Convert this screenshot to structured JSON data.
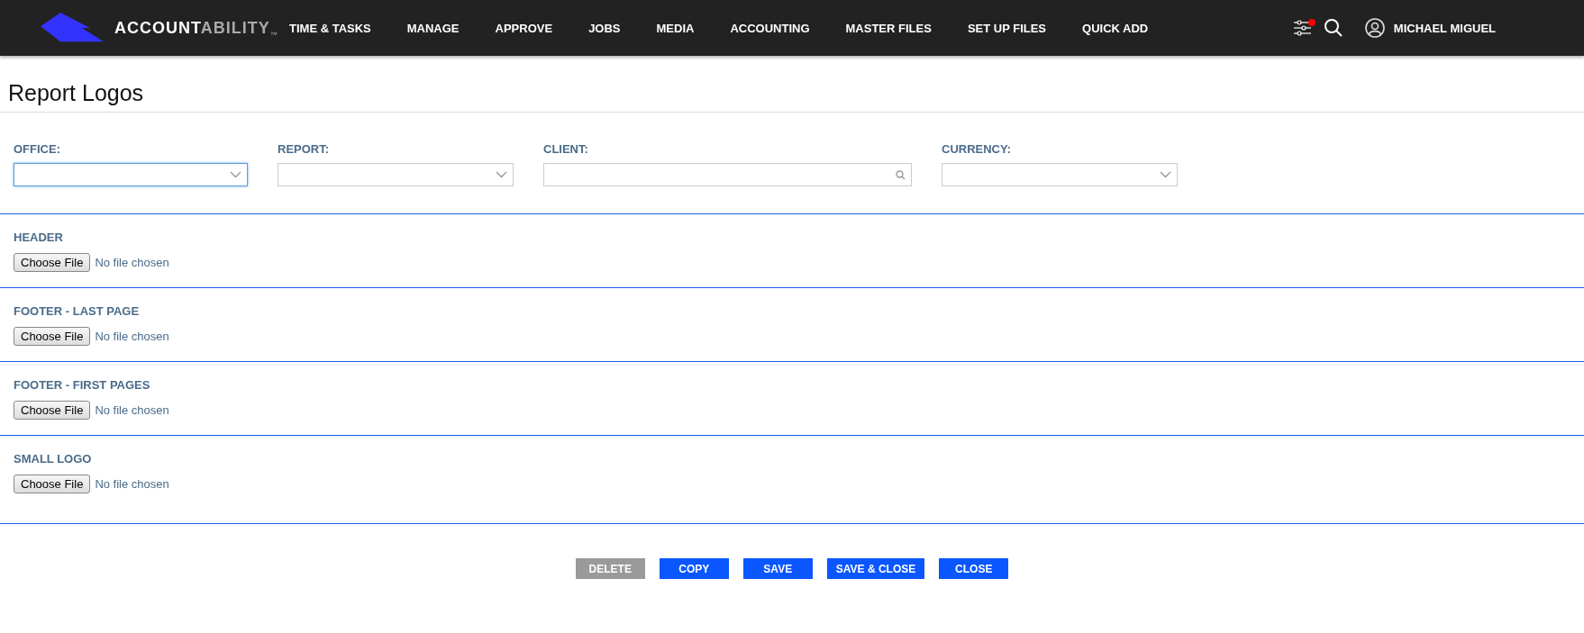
{
  "navbar": {
    "logo_text": "ACCOUNT",
    "logo_text_accent": "ABILITY",
    "trademark": "™",
    "menu": [
      {
        "label": "TIME & TASKS"
      },
      {
        "label": "MANAGE"
      },
      {
        "label": "APPROVE"
      },
      {
        "label": "JOBS"
      },
      {
        "label": "MEDIA"
      },
      {
        "label": "ACCOUNTING"
      },
      {
        "label": "MASTER FILES"
      },
      {
        "label": "SET UP FILES"
      },
      {
        "label": "QUICK ADD"
      }
    ],
    "filters_notification": true,
    "user_name": "MICHAEL MIGUEL"
  },
  "page_title": "Report Logos",
  "filters": [
    {
      "label": "OFFICE:",
      "kind": "select",
      "focused": true
    },
    {
      "label": "REPORT:",
      "kind": "select",
      "focused": false
    },
    {
      "label": "CLIENT:",
      "kind": "search",
      "focused": false
    },
    {
      "label": "CURRENCY:",
      "kind": "select",
      "focused": false
    }
  ],
  "logo_sections": [
    {
      "label": "HEADER",
      "button": "Choose File",
      "status": "No file chosen"
    },
    {
      "label": "FOOTER - LAST PAGE",
      "button": "Choose File",
      "status": "No file chosen"
    },
    {
      "label": "FOOTER - FIRST PAGES",
      "button": "Choose File",
      "status": "No file chosen"
    },
    {
      "label": "SMALL LOGO",
      "button": "Choose File",
      "status": "No file chosen"
    }
  ],
  "actions": [
    {
      "label": "DELETE",
      "disabled": true
    },
    {
      "label": "COPY",
      "disabled": false
    },
    {
      "label": "SAVE",
      "disabled": false
    },
    {
      "label": "SAVE & CLOSE",
      "disabled": false
    },
    {
      "label": "CLOSE",
      "disabled": false
    }
  ]
}
